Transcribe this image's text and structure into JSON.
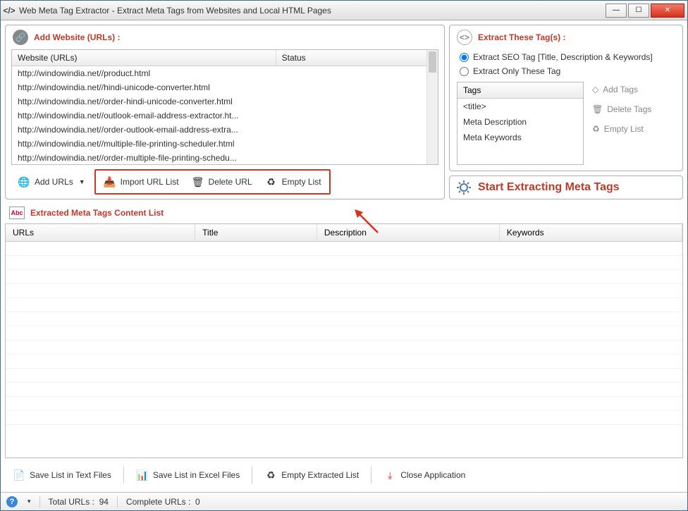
{
  "window": {
    "title": "Web Meta Tag Extractor - Extract Meta Tags from Websites and Local HTML Pages"
  },
  "addPanel": {
    "title": "Add Website (URLs) :",
    "columns": {
      "url": "Website (URLs)",
      "status": "Status"
    },
    "rows": [
      "http://windowindia.net//product.html",
      "http://windowindia.net//hindi-unicode-converter.html",
      "http://windowindia.net//order-hindi-unicode-converter.html",
      "http://windowindia.net//outlook-email-address-extractor.ht...",
      "http://windowindia.net//order-outlook-email-address-extra...",
      "http://windowindia.net//multiple-file-printing-scheduler.html",
      "http://windowindia.net//order-multiple-file-printing-schedu..."
    ],
    "toolbar": {
      "addUrls": "Add URLs",
      "importList": "Import URL List",
      "deleteUrl": "Delete URL",
      "emptyList": "Empty List"
    }
  },
  "extractPanel": {
    "title": "Extract These Tag(s) :",
    "radio1": "Extract SEO Tag [Title, Description & Keywords]",
    "radio2": "Extract Only These Tag",
    "tagsHeader": "Tags",
    "tags": [
      "<title>",
      "Meta Description",
      "Meta Keywords"
    ],
    "buttons": {
      "add": "Add Tags",
      "delete": "Delete Tags",
      "empty": "Empty List"
    },
    "start": "Start Extracting Meta Tags"
  },
  "extracted": {
    "title": "Extracted Meta Tags Content List",
    "columns": {
      "urls": "URLs",
      "title": "Title",
      "desc": "Description",
      "keywords": "Keywords"
    }
  },
  "bottom": {
    "saveText": "Save List in Text Files",
    "saveExcel": "Save List in Excel Files",
    "emptyExtracted": "Empty Extracted List",
    "close": "Close Application"
  },
  "status": {
    "totalLabel": "Total URLs :",
    "totalValue": "94",
    "completeLabel": "Complete URLs :",
    "completeValue": "0"
  }
}
